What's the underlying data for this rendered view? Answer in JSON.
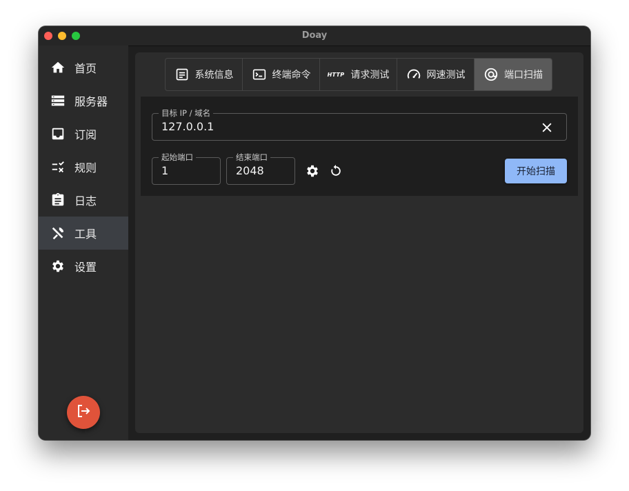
{
  "window": {
    "title": "Doay"
  },
  "sidebar": {
    "items": [
      {
        "label": "首页",
        "icon": "home-icon"
      },
      {
        "label": "服务器",
        "icon": "server-icon"
      },
      {
        "label": "订阅",
        "icon": "inbox-icon"
      },
      {
        "label": "规则",
        "icon": "rules-icon"
      },
      {
        "label": "日志",
        "icon": "clipboard-icon"
      },
      {
        "label": "工具",
        "icon": "tools-icon",
        "active": true
      },
      {
        "label": "设置",
        "icon": "gear-icon"
      }
    ],
    "logout_icon": "logout-icon"
  },
  "tabs": [
    {
      "label": "系统信息",
      "icon": "sysinfo-icon"
    },
    {
      "label": "终端命令",
      "icon": "terminal-icon"
    },
    {
      "label": "请求测试",
      "icon_text": "HTTP"
    },
    {
      "label": "网速测试",
      "icon": "speedometer-icon"
    },
    {
      "label": "端口扫描",
      "icon": "at-icon",
      "active": true
    }
  ],
  "scan": {
    "target_label": "目标 IP / 域名",
    "target_value": "127.0.0.1",
    "start_port_label": "起始端口",
    "start_port_value": "1",
    "end_port_label": "结束端口",
    "end_port_value": "2048",
    "start_button": "开始扫描"
  },
  "colors": {
    "accent": "#8fb8f7",
    "logout": "#e0533a",
    "active_nav": "#3c3f44"
  }
}
